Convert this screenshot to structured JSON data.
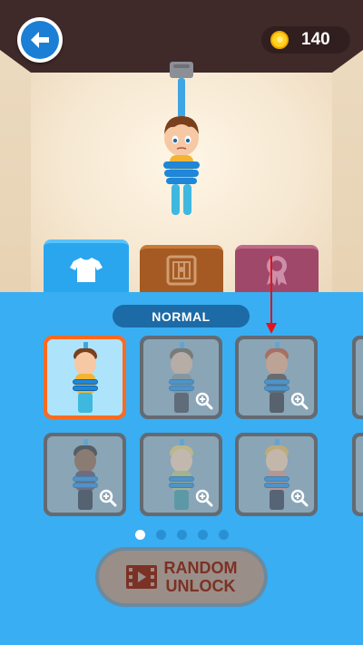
{
  "header": {
    "back_icon": "arrow-left-icon",
    "coins": "140",
    "coin_icon": "gold-coin-icon"
  },
  "scene": {
    "preview_character": "boy-yellow-shirt"
  },
  "tabs": [
    {
      "icon": "shirt-icon",
      "active": true,
      "color": "#2aa6ee"
    },
    {
      "icon": "crate-icon",
      "active": false,
      "color": "#a55a24"
    },
    {
      "icon": "award-ribbon-icon",
      "active": false,
      "color": "#a0486a"
    }
  ],
  "section": {
    "label": "NORMAL"
  },
  "grid": [
    {
      "id": "boy-yellow",
      "selected": true,
      "locked": false
    },
    {
      "id": "man-grey",
      "selected": false,
      "locked": true,
      "icon": "zoom-in-icon"
    },
    {
      "id": "man-red-beard",
      "selected": false,
      "locked": true,
      "icon": "zoom-in-icon"
    },
    {
      "id": "man-dark",
      "selected": false,
      "locked": true,
      "icon": "zoom-in-icon"
    },
    {
      "id": "woman-blonde-bun",
      "selected": false,
      "locked": true,
      "icon": "zoom-in-icon"
    },
    {
      "id": "woman-blonde-ponytail",
      "selected": false,
      "locked": true,
      "icon": "zoom-in-icon"
    }
  ],
  "pagination": {
    "pages": 5,
    "current": 1
  },
  "random_button": {
    "line1": "RANDOM",
    "line2": "UNLOCK",
    "icon": "film-reel-icon"
  },
  "colors": {
    "panel": "#39aef2",
    "selected_border": "#ff6a1f",
    "label_bg": "#1c6aa6",
    "arrow": "#e0141c"
  }
}
